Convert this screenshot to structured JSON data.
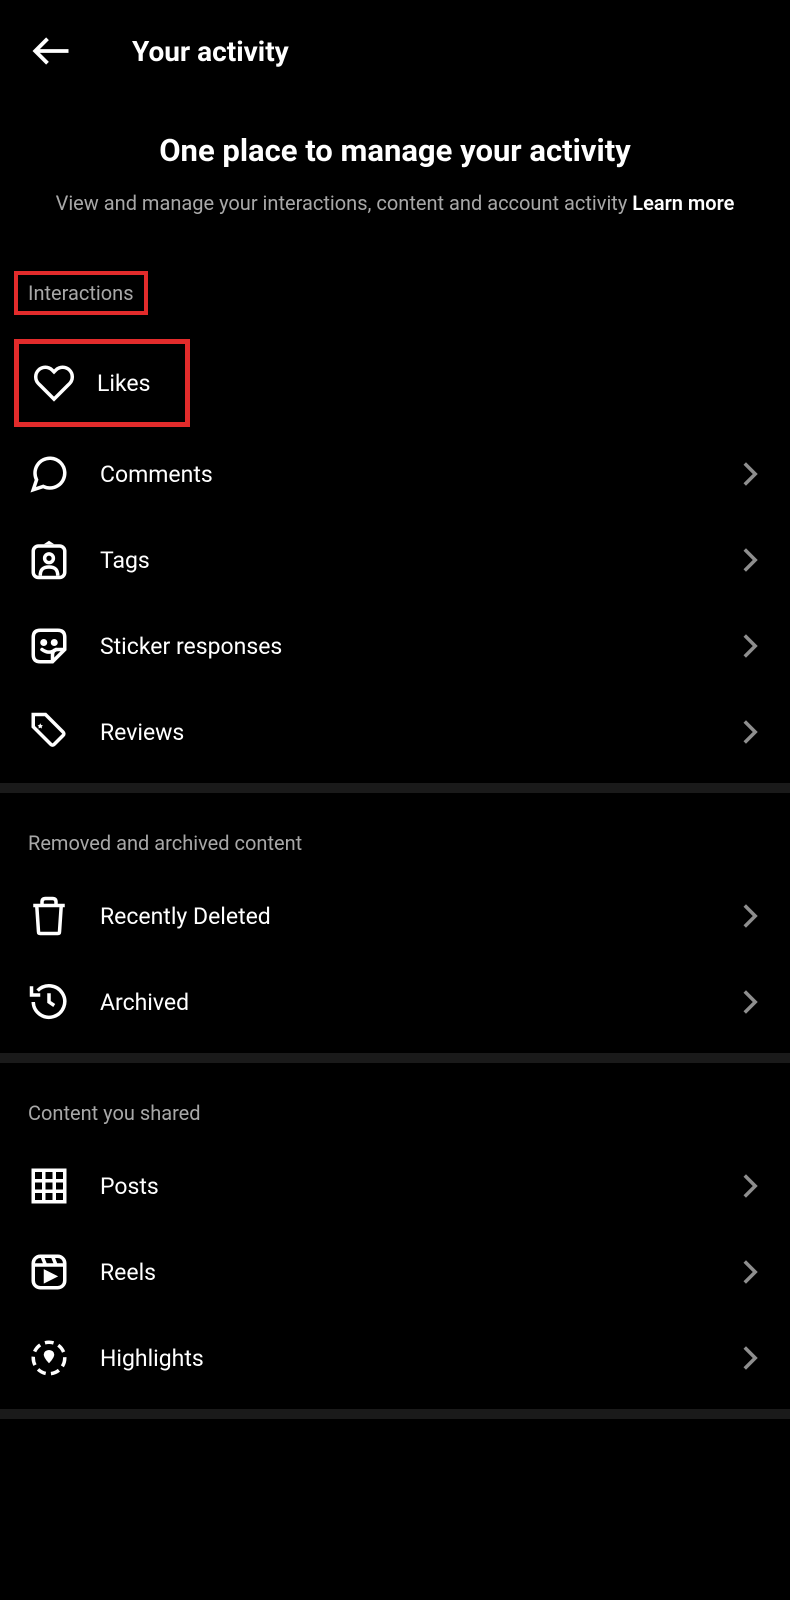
{
  "header": {
    "title": "Your activity"
  },
  "intro": {
    "title": "One place to manage your activity",
    "subtitle_pre": "View and manage your interactions, content and account activity ",
    "learn_more": "Learn more"
  },
  "sections": {
    "interactions": {
      "header": "Interactions",
      "items": {
        "likes": "Likes",
        "comments": "Comments",
        "tags": "Tags",
        "sticker_responses": "Sticker responses",
        "reviews": "Reviews"
      }
    },
    "removed": {
      "header": "Removed and archived content",
      "items": {
        "recently_deleted": "Recently Deleted",
        "archived": "Archived"
      }
    },
    "content_shared": {
      "header": "Content you shared",
      "items": {
        "posts": "Posts",
        "reels": "Reels",
        "highlights": "Highlights"
      }
    }
  }
}
